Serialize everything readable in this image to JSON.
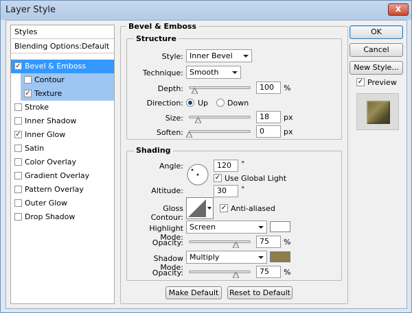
{
  "window": {
    "title": "Layer Style",
    "close_label": "x"
  },
  "styles_panel": {
    "header": "Styles",
    "blending_options": "Blending Options:Default",
    "items": [
      {
        "label": "Bevel & Emboss",
        "checked": true
      },
      {
        "label": "Contour",
        "checked": false
      },
      {
        "label": "Texture",
        "checked": true
      },
      {
        "label": "Stroke",
        "checked": false
      },
      {
        "label": "Inner Shadow",
        "checked": false
      },
      {
        "label": "Inner Glow",
        "checked": true
      },
      {
        "label": "Satin",
        "checked": false
      },
      {
        "label": "Color Overlay",
        "checked": false
      },
      {
        "label": "Gradient Overlay",
        "checked": false
      },
      {
        "label": "Pattern Overlay",
        "checked": false
      },
      {
        "label": "Outer Glow",
        "checked": false
      },
      {
        "label": "Drop Shadow",
        "checked": false
      }
    ],
    "check_glyph": "✓"
  },
  "bevel": {
    "section_title": "Bevel & Emboss",
    "structure": {
      "title": "Structure",
      "style_label": "Style:",
      "style_value": "Inner Bevel",
      "technique_label": "Technique:",
      "technique_value": "Smooth",
      "depth_label": "Depth:",
      "depth_value": "100",
      "depth_unit": "%",
      "direction_label": "Direction:",
      "direction_up": "Up",
      "direction_down": "Down",
      "direction_selected": "Up",
      "size_label": "Size:",
      "size_value": "18",
      "size_unit": "px",
      "soften_label": "Soften:",
      "soften_value": "0",
      "soften_unit": "px"
    },
    "shading": {
      "title": "Shading",
      "angle_label": "Angle:",
      "angle_value": "120",
      "degree": "°",
      "global_light_label": "Use Global Light",
      "altitude_label": "Altitude:",
      "altitude_value": "30",
      "gloss_contour_label": "Gloss Contour:",
      "anti_aliased_label": "Anti-aliased",
      "highlight_mode_label": "Highlight Mode:",
      "highlight_mode_value": "Screen",
      "highlight_color": "#ffffff",
      "highlight_opacity_label": "Opacity:",
      "highlight_opacity_value": "75",
      "opacity_unit": "%",
      "shadow_mode_label": "Shadow Mode:",
      "shadow_mode_value": "Multiply",
      "shadow_color": "#8f7b4c",
      "shadow_opacity_label": "Opacity:",
      "shadow_opacity_value": "75"
    },
    "make_default": "Make Default",
    "reset_default": "Reset to Default"
  },
  "buttons": {
    "ok": "OK",
    "cancel": "Cancel",
    "new_style": "New Style..."
  },
  "preview": {
    "label": "Preview",
    "checked": true
  },
  "colors": {
    "selection": "#3399ff",
    "selection_sub": "#9ec6f2",
    "window_frame": "#dde7f2"
  }
}
